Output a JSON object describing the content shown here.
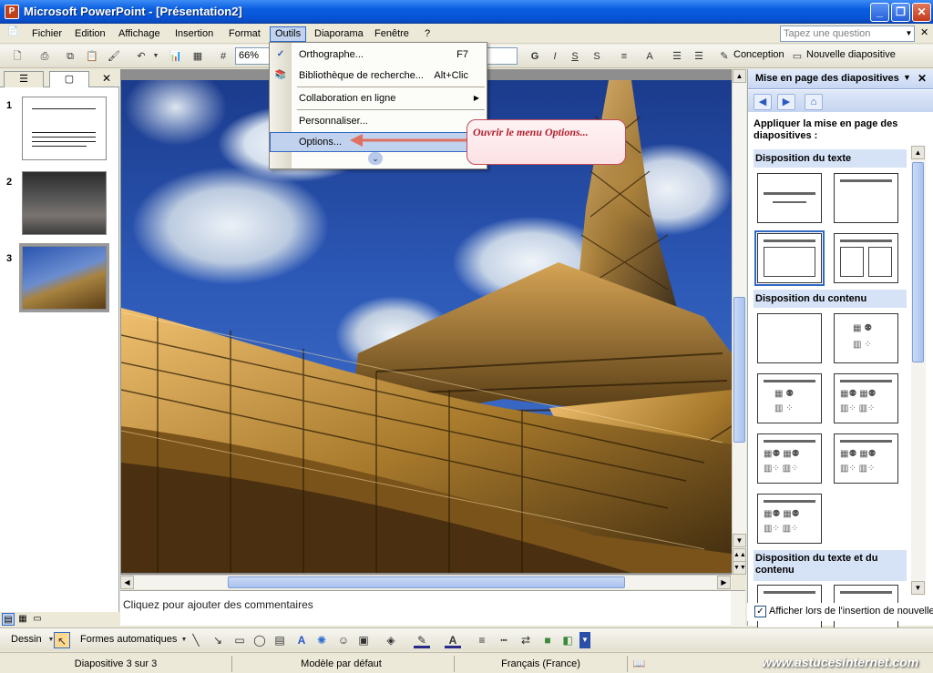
{
  "window": {
    "title": "Microsoft PowerPoint - [Présentation2]",
    "app_icon": "powerpoint-icon",
    "controls": {
      "minimize": "_",
      "restore": "❐",
      "close": "✕"
    }
  },
  "menubar": {
    "items": [
      "Fichier",
      "Edition",
      "Affichage",
      "Insertion",
      "Format",
      "Outils",
      "Diaporama",
      "Fenêtre",
      "?"
    ],
    "active": "Outils",
    "help_placeholder": "Tapez une question"
  },
  "toolbar": {
    "zoom": "66%",
    "icons": [
      "new-icon",
      "print-icon",
      "copy-icon",
      "paste-icon",
      "format-painter-icon",
      "undo-icon",
      "chart-icon",
      "grid-icon"
    ],
    "format_icons": {
      "bold": "G",
      "italic": "I",
      "underline": "S",
      "shadow": "S"
    },
    "design_label": "Conception",
    "new_slide_label": "Nouvelle diapositive"
  },
  "outils_menu": {
    "items": [
      {
        "label": "Orthographe...",
        "shortcut": "F7",
        "icon": "spelling-icon"
      },
      {
        "label": "Bibliothèque de recherche...",
        "shortcut": "Alt+Clic",
        "icon": "research-icon"
      },
      {
        "label": "Collaboration en ligne",
        "shortcut": "",
        "submenu": true
      },
      {
        "label": "Personnaliser...",
        "shortcut": ""
      },
      {
        "label": "Options...",
        "shortcut": ""
      }
    ],
    "highlighted": "Options...",
    "expand_icon": "double-chevron-down-icon"
  },
  "callout": {
    "text": "Ouvrir le menu Options..."
  },
  "slides_panel": {
    "tabs": [
      "outline-tab",
      "slides-tab"
    ],
    "slides": [
      {
        "number": "1",
        "kind": "text"
      },
      {
        "number": "2",
        "kind": "city-photo"
      },
      {
        "number": "3",
        "kind": "eiffel-photo",
        "selected": true
      }
    ]
  },
  "notes": {
    "placeholder": "Cliquez pour ajouter des commentaires"
  },
  "task_pane": {
    "title": "Mise en page des diapositives",
    "apply_label": "Appliquer la mise en page des diapositives :",
    "sections": [
      "Disposition du texte",
      "Disposition du contenu",
      "Disposition du texte et du contenu"
    ],
    "show_on_insert_label": "Afficher lors de l'insertion de nouvelle",
    "show_on_insert_checked": true
  },
  "drawing_toolbar": {
    "draw_label": "Dessin",
    "autoshapes_label": "Formes automatiques"
  },
  "statusbar": {
    "slide_info": "Diapositive 3 sur 3",
    "design": "Modèle par défaut",
    "language": "Français (France)",
    "watermark": "www.astucesinternet.com"
  }
}
